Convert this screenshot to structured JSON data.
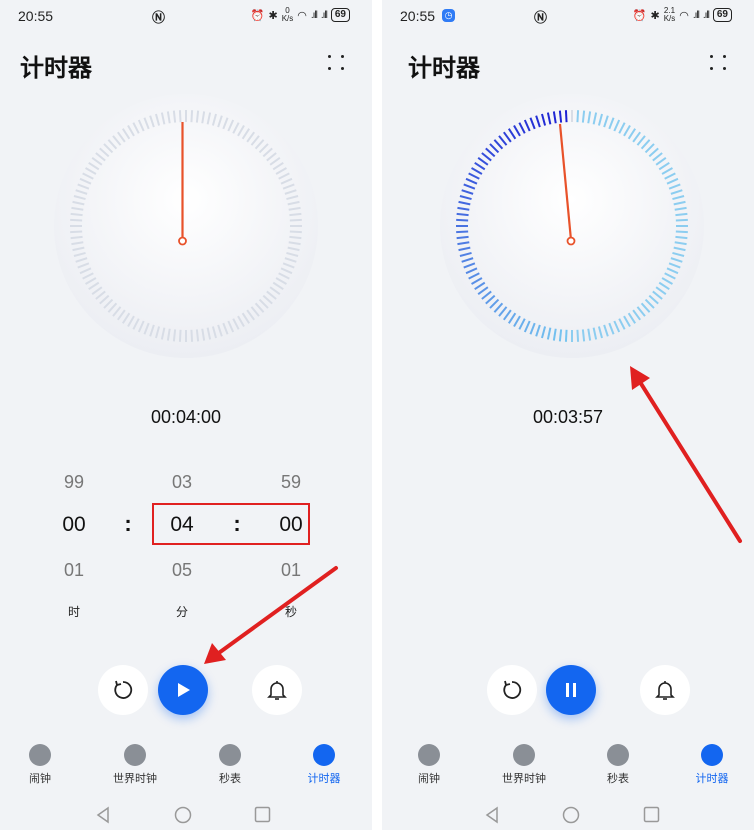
{
  "colors": {
    "accent": "#1366f0",
    "hand": "#e8522a",
    "annotation": "#e02020",
    "background": "#f1f3f6"
  },
  "left": {
    "status": {
      "time": "20:55",
      "battery": "69"
    },
    "title": "计时器",
    "readout": "00:04:00",
    "picker": {
      "hours": {
        "prev": "99",
        "current": "00",
        "next": "01",
        "unit": "时"
      },
      "minutes": {
        "prev": "03",
        "current": "04",
        "next": "05",
        "unit": "分"
      },
      "seconds": {
        "prev": "59",
        "current": "00",
        "next": "01",
        "unit": "秒"
      },
      "separator": ":"
    },
    "controls": {
      "main_state": "play"
    }
  },
  "right": {
    "status": {
      "time": "20:55",
      "net_value": "2.1",
      "net_unit": "K/s",
      "battery": "69"
    },
    "title": "计时器",
    "readout": "00:03:57",
    "progress_remaining_fraction": 0.9875,
    "controls": {
      "main_state": "pause"
    }
  },
  "left_status_net": {
    "value": "0",
    "unit": "K/s"
  },
  "tabs": [
    {
      "label": "闹钟",
      "icon": "alarm-clock-icon"
    },
    {
      "label": "世界时钟",
      "icon": "globe-icon"
    },
    {
      "label": "秒表",
      "icon": "stopwatch-icon"
    },
    {
      "label": "计时器",
      "icon": "timer-icon",
      "active": true
    }
  ]
}
